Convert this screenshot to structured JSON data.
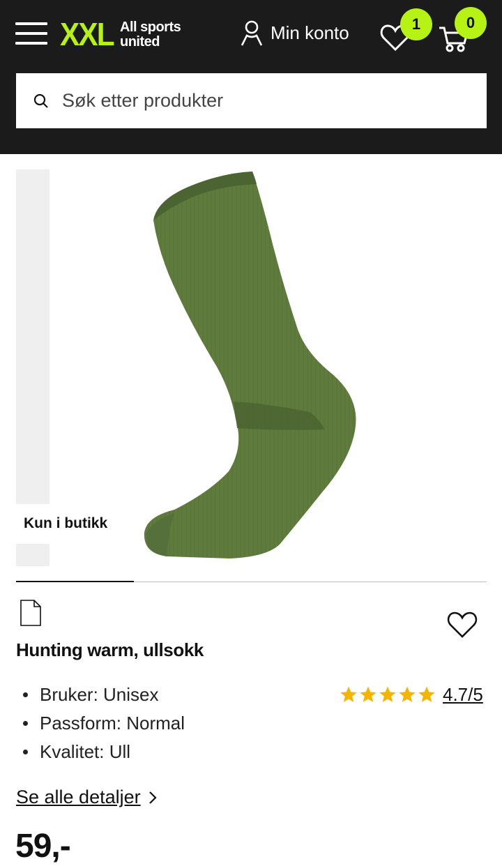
{
  "header": {
    "logo": {
      "mark": "XXL",
      "tagline": "All sports united"
    },
    "account_label": "Min konto",
    "wishlist_count": "1",
    "cart_count": "0",
    "search": {
      "placeholder": "Søk etter produkter"
    }
  },
  "colors": {
    "header_bg": "#1b1b1b",
    "accent": "#b6f214",
    "star": "#f5b400",
    "sock": "#5d7a3a"
  },
  "gallery": {
    "badge": "Kun i butikk",
    "image_progress": 0.25
  },
  "product": {
    "title": "Hunting warm, ullsokk",
    "features": [
      "Bruker: Unisex",
      "Passform: Normal",
      "Kvalitet: Ull"
    ],
    "rating": {
      "stars": 5,
      "value": "4.7/5"
    },
    "details_link": "Se alle detaljer",
    "price": "59,-"
  },
  "icons": [
    "menu-icon",
    "user-icon",
    "heart-icon",
    "cart-icon",
    "search-icon",
    "document-icon",
    "star-icon",
    "chevron-right-icon"
  ]
}
